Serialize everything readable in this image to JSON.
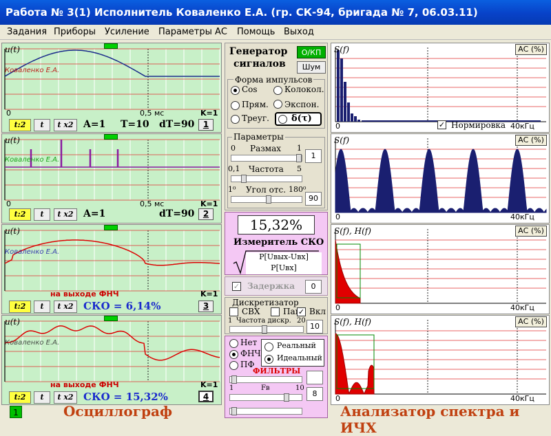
{
  "title": "Работа № 3(1)  Исполнитель Коваленко Е.А. (гр. СК-94, бригада № 7, 06.03.11)",
  "menu": [
    "Задания",
    "Приборы",
    "Усиление",
    "Параметры АС",
    "Помощь",
    "Выход"
  ],
  "osc": {
    "ulabel": "u(t)",
    "author": "Коваленко Е.А.",
    "tick0": "0",
    "tick05": "0,5 мс",
    "k1": "K=1",
    "btn_t2": "t:2",
    "btn_t": "t",
    "btn_tx2": "t x2",
    "panel1": {
      "A": "A=1",
      "T": "T=10",
      "dT": "dT=90",
      "num": "1"
    },
    "panel2": {
      "A": "A=1",
      "dT": "dT=90",
      "num": "2"
    },
    "panel3": {
      "fnch": "на выходе ФНЧ",
      "sko": "СКО = 6,14%",
      "num": "3"
    },
    "panel4": {
      "fnch": "на выходе ФНЧ",
      "sko": "СКО = 15,32%",
      "num": "4"
    }
  },
  "gen": {
    "title1": "Генератор",
    "title2": "сигналов",
    "okp": "О/КП",
    "noise": "Шум",
    "form_title": "Форма  импульсов",
    "cos": "Cos",
    "kolokol": "Колокол.",
    "pryam": "Прям.",
    "expon": "Экспон.",
    "treug": "Треуг.",
    "delta": "δ(τ)"
  },
  "params": {
    "title": "Параметры",
    "razmax": "Размах",
    "r0": "0",
    "r1": "1",
    "rval": "1",
    "freq": "Частота",
    "f0": "0,1",
    "f5": "5",
    "angle": "Угол отс.",
    "a0": "1⁰",
    "a180": "180⁰",
    "aval": "90"
  },
  "meter": {
    "value": "15,32%",
    "label": "Измеритель СКО",
    "num": "P[Uвых-Uвх]",
    "den": "P[Uвх]"
  },
  "delay": {
    "label": "Задержка",
    "val": "0"
  },
  "disc": {
    "title": "Дискретизатор",
    "svh": "СВХ",
    "pam": "Пам",
    "vkl": "Вкл",
    "s1": "1",
    "freq": "Частота дискр.",
    "s20": "20",
    "val": "10"
  },
  "filters": {
    "net": "Нет",
    "fnch": "ФНЧ",
    "pf": "ПФ",
    "real": "Реальный",
    "ideal": "Идеальный",
    "title": "ФИЛЬТРЫ",
    "f1": "1",
    "fv": "Fв",
    "f10": "10",
    "val": "8"
  },
  "spec": {
    "s1": "S(f)",
    "s2": "S(f)",
    "s3": "S(f), H(f)",
    "s4": "S(f), H(f)",
    "ac": "АС (%)",
    "tick0": "0",
    "tick40": "40кГц",
    "norm": "Нормировка"
  },
  "bottom": {
    "indicator": "1",
    "osc": "Осциллограф",
    "spec": "Анализатор спектра и ИЧХ"
  }
}
